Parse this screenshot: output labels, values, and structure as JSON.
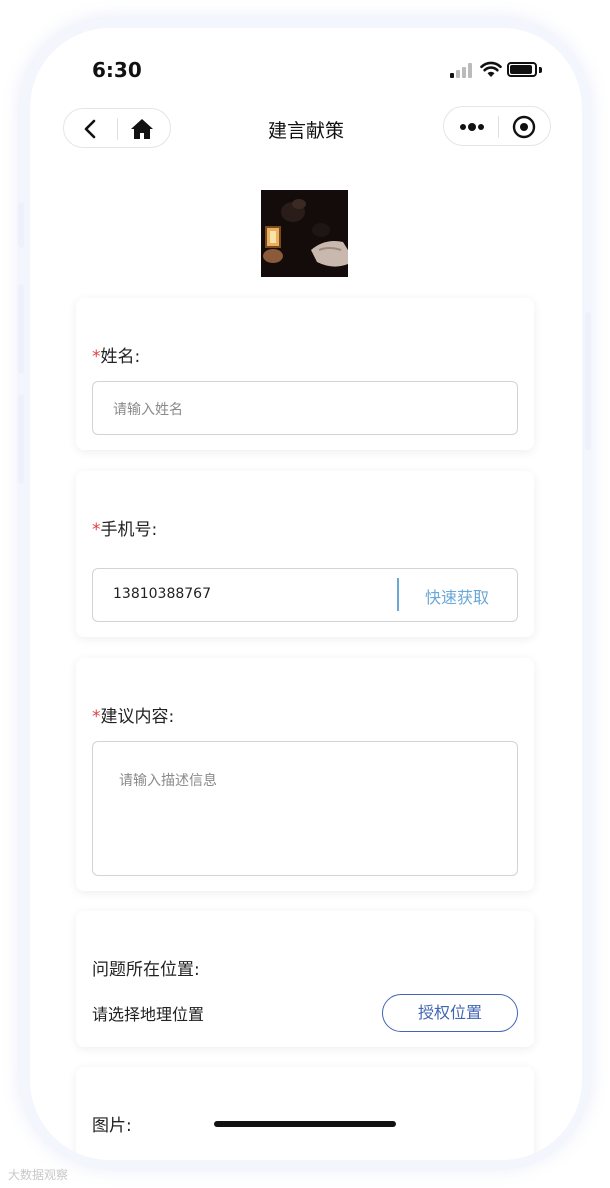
{
  "status_bar": {
    "time": "6:30"
  },
  "nav": {
    "title": "建言献策"
  },
  "form": {
    "required_mark": "*",
    "name": {
      "label": "姓名:",
      "placeholder": "请输入姓名"
    },
    "phone": {
      "label": "手机号:",
      "value": "13810388767",
      "quick_get": "快速获取"
    },
    "suggestion": {
      "label": "建议内容:",
      "placeholder": "请输入描述信息"
    },
    "location": {
      "label": "问题所在位置:",
      "prompt": "请选择地理位置",
      "auth_button": "授权位置"
    },
    "images": {
      "label": "图片:"
    }
  },
  "watermark": "大数据观察",
  "colors": {
    "accent_blue": "#4266b4",
    "link_blue": "#6aa8d8",
    "required_red": "#e04040"
  },
  "icons": [
    "back-icon",
    "home-icon",
    "more-icon",
    "target-icon",
    "signal-icon",
    "wifi-icon",
    "battery-icon"
  ]
}
